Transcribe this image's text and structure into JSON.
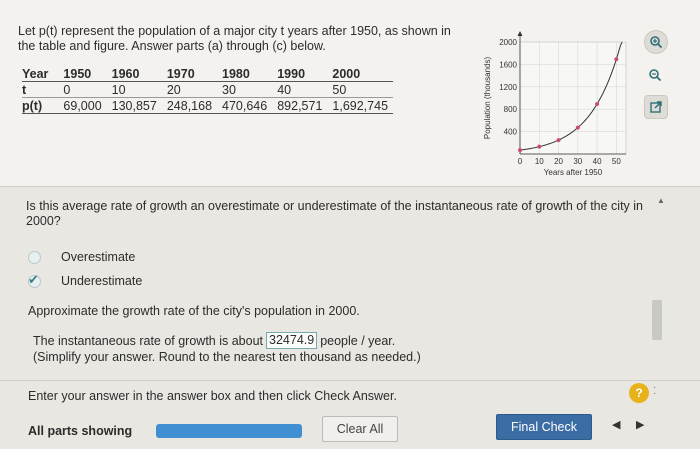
{
  "prompt": {
    "line1": "Let p(t) represent the population of a major city t years after 1950, as shown in",
    "line2": "the table and figure. Answer parts (a) through (c) below."
  },
  "table": {
    "year_label": "Year",
    "years": [
      "1950",
      "1960",
      "1970",
      "1980",
      "1990",
      "2000"
    ],
    "t_label": "t",
    "t_values": [
      "0",
      "10",
      "20",
      "30",
      "40",
      "50"
    ],
    "p_label": "p(t)",
    "p_values": [
      "69,000",
      "130,857",
      "248,168",
      "470,646",
      "892,571",
      "1,692,745"
    ]
  },
  "chart_data": {
    "type": "scatter",
    "x": [
      0,
      10,
      20,
      30,
      40,
      50
    ],
    "y": [
      69.0,
      130.857,
      248.168,
      470.646,
      892.571,
      1692.745
    ],
    "ylabel": "Population (thousands)",
    "xlabel": "Years after 1950",
    "xticks": [
      "0",
      "10",
      "20",
      "30",
      "40",
      "50"
    ],
    "yticks": [
      "400",
      "800",
      "1200",
      "1600",
      "2000"
    ],
    "xlim": [
      0,
      55
    ],
    "ylim": [
      0,
      2000
    ],
    "curve_color": "#333333",
    "point_color": "#c94b7a"
  },
  "question": {
    "text": "Is this average rate of growth an overestimate or underestimate of the instantaneous rate of growth of the city in 2000?"
  },
  "options": [
    {
      "label": "Overestimate",
      "selected": false
    },
    {
      "label": "Underestimate",
      "selected": true
    }
  ],
  "part_c": {
    "prompt": "Approximate the growth rate of the city's population in 2000.",
    "answer_prefix": "The instantaneous rate of growth is about",
    "answer_value": "32474.9",
    "answer_suffix": "people / year.",
    "hint": "(Simplify your answer. Round to the nearest ten thousand as needed.)"
  },
  "footer": {
    "instruction": "Enter your answer in the answer box and then click Check Answer.",
    "status": "All parts showing",
    "progress": 1.0,
    "clear_label": "Clear All",
    "final_label": "Final Check",
    "help_label": "?"
  },
  "icons": {
    "zoom_in": "zoom-in-icon",
    "zoom_out": "zoom-out-icon",
    "popout": "popout-icon",
    "prev": "triangle-left-icon",
    "next": "triangle-right-icon"
  },
  "colors": {
    "accent": "#3c6ca4",
    "progress": "#3f8fd2",
    "help": "#e8b21a"
  }
}
